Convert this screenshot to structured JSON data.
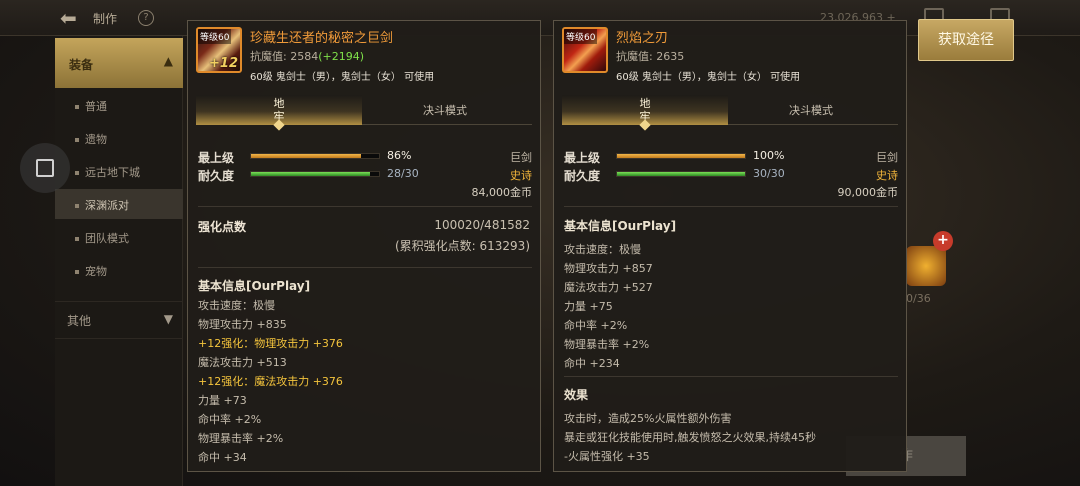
{
  "header": {
    "title": "制作",
    "help_label": "?",
    "resource_gold": "23,026,963 +"
  },
  "sidebar": {
    "section_label": "装备",
    "items": [
      {
        "label": "普通"
      },
      {
        "label": "遗物"
      },
      {
        "label": "远古地下城"
      },
      {
        "label": "深渊派对"
      },
      {
        "label": "团队模式"
      },
      {
        "label": "宠物"
      }
    ],
    "other_label": "其他"
  },
  "get_route_button": "获取途径",
  "background": {
    "count_text": "0/36",
    "make_button": "作"
  },
  "item1": {
    "name": "珍藏生还者的秘密之巨剑",
    "level_tag": "等级60",
    "enhance_tag": "+12",
    "magic_resist_label": "抗魔值:",
    "magic_resist_value": "2584",
    "magic_resist_bonus": "(+2194)",
    "requirement": "60级 鬼剑士（男），鬼剑士（女） 可使用",
    "tabs": [
      "地牢",
      "决斗模式"
    ],
    "max_level_label": "最上级",
    "max_level_percent": 86,
    "max_level_text": "86%",
    "durability_label": "耐久度",
    "durability_current": 28,
    "durability_max": 30,
    "durability_text": "28/30",
    "weapon_type": "巨剑",
    "rarity": "史诗",
    "price": "84,000金币",
    "reinforce_label": "强化点数",
    "reinforce_value": "100020/481582",
    "reinforce_total": "(累积强化点数: 613293)",
    "basic_info_title": "基本信息[OurPlay]",
    "basic_lines": [
      {
        "text": "攻击速度：极慢",
        "gold": false
      },
      {
        "text": "物理攻击力 +835",
        "gold": false
      },
      {
        "text": "+12强化：物理攻击力 +376",
        "gold": true
      },
      {
        "text": "魔法攻击力 +513",
        "gold": false
      },
      {
        "text": "+12强化：魔法攻击力 +376",
        "gold": true
      },
      {
        "text": "力量 +73",
        "gold": false
      },
      {
        "text": "命中率 +2%",
        "gold": false
      },
      {
        "text": "物理暴击率 +2%",
        "gold": false
      },
      {
        "text": "命中 +34",
        "gold": false
      }
    ]
  },
  "item2": {
    "name": "烈焰之刃",
    "level_tag": "等级60",
    "magic_resist_label": "抗魔值:",
    "magic_resist_value": "2635",
    "requirement": "60级 鬼剑士（男），鬼剑士（女） 可使用",
    "tabs": [
      "地牢",
      "决斗模式"
    ],
    "max_level_label": "最上级",
    "max_level_percent": 100,
    "max_level_text": "100%",
    "durability_label": "耐久度",
    "durability_current": 30,
    "durability_max": 30,
    "durability_text": "30/30",
    "weapon_type": "巨剑",
    "rarity": "史诗",
    "price": "90,000金币",
    "basic_info_title": "基本信息[OurPlay]",
    "basic_lines": [
      {
        "text": "攻击速度：极慢"
      },
      {
        "text": "物理攻击力 +857"
      },
      {
        "text": "魔法攻击力 +527"
      },
      {
        "text": "力量 +75"
      },
      {
        "text": "命中率 +2%"
      },
      {
        "text": "物理暴击率 +2%"
      },
      {
        "text": "命中 +234"
      }
    ],
    "effect_title": "效果",
    "effect_lines": [
      "攻击时，造成25%火属性额外伤害",
      "暴走或狂化技能使用时,触发愤怒之火效果,持续45秒",
      "-火属性强化 +35"
    ]
  },
  "colors": {
    "item_name": "#ef9a39",
    "rarity_epic": "#f1b43a",
    "bonus_green": "#7fe04a",
    "enhance_gold": "#f4c43c",
    "accent_button": "#c7a864"
  }
}
